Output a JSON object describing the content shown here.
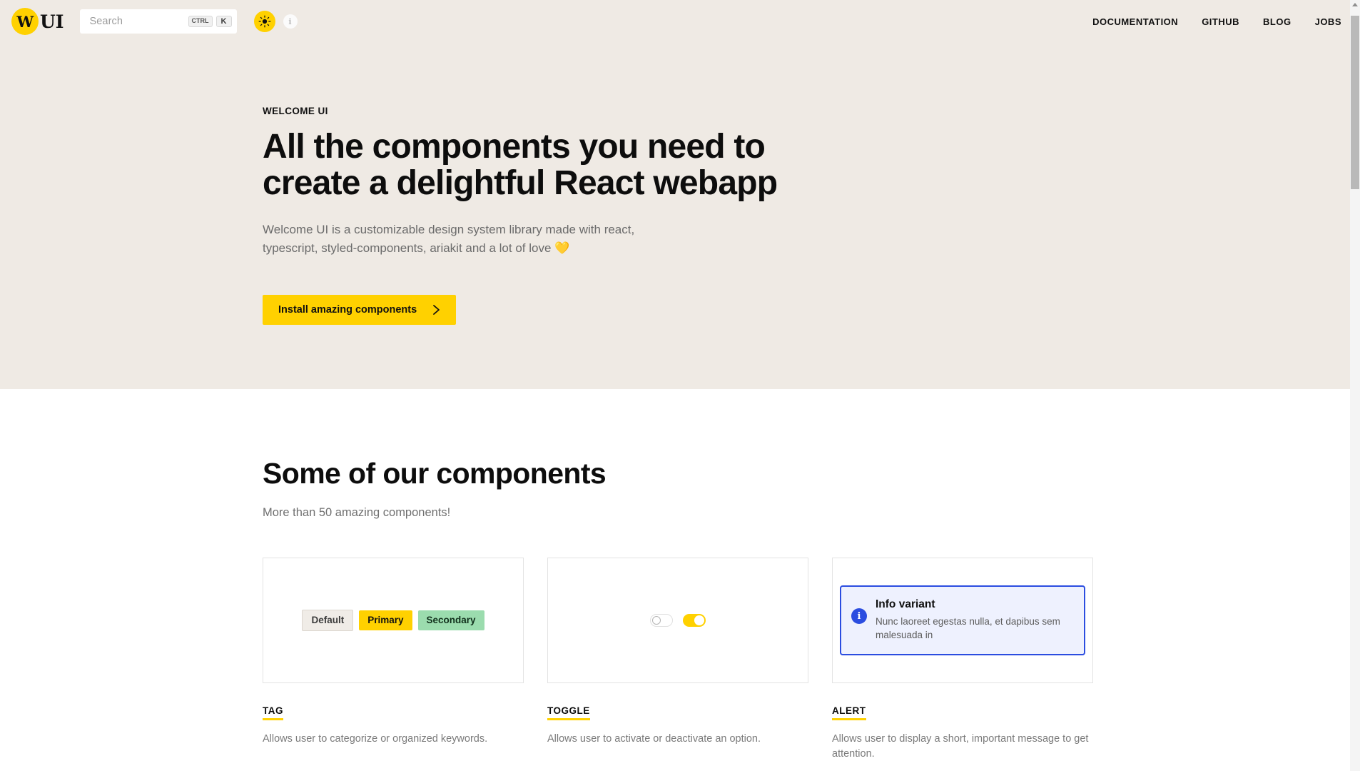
{
  "header": {
    "brand": {
      "mark_letter": "W",
      "text": "UI"
    },
    "search": {
      "placeholder": "Search",
      "kbd_modifier": "CTRL",
      "kbd_key": "K"
    },
    "theme_toggle_icon": "sun-icon",
    "info_icon_glyph": "i",
    "nav": [
      {
        "label": "DOCUMENTATION"
      },
      {
        "label": "GITHUB"
      },
      {
        "label": "BLOG"
      },
      {
        "label": "JOBS"
      }
    ]
  },
  "hero": {
    "eyebrow": "WELCOME UI",
    "title_line1": "All the components you need to",
    "title_line2": "create a delightful React webapp",
    "subtitle_line1": "Welcome UI is a customizable design system library made with react,",
    "subtitle_line2": "typescript, styled-components, ariakit and a lot of love 💛",
    "cta_label": "Install amazing components"
  },
  "components": {
    "title": "Some of our components",
    "subtitle": "More than 50 amazing components!",
    "cards": [
      {
        "label": "TAG",
        "description": "Allows user to categorize or organized keywords.",
        "tags": [
          {
            "text": "Default",
            "variant": "default"
          },
          {
            "text": "Primary",
            "variant": "primary"
          },
          {
            "text": "Secondary",
            "variant": "secondary"
          }
        ]
      },
      {
        "label": "TOGGLE",
        "description": "Allows user to activate or deactivate an option.",
        "toggles": [
          {
            "state": "off"
          },
          {
            "state": "on"
          }
        ]
      },
      {
        "label": "ALERT",
        "description": "Allows user to display a short, important message to get attention.",
        "alert": {
          "icon_glyph": "i",
          "title": "Info variant",
          "body": "Nunc laoreet egestas nulla, et dapibus sem malesuada in"
        }
      }
    ]
  },
  "colors": {
    "brand_yellow": "#FFD100",
    "hero_background": "#EFEAE4",
    "secondary_green": "#9BDCAE",
    "info_blue": "#2B4DE0",
    "info_blue_bg": "#EEF1FE"
  }
}
